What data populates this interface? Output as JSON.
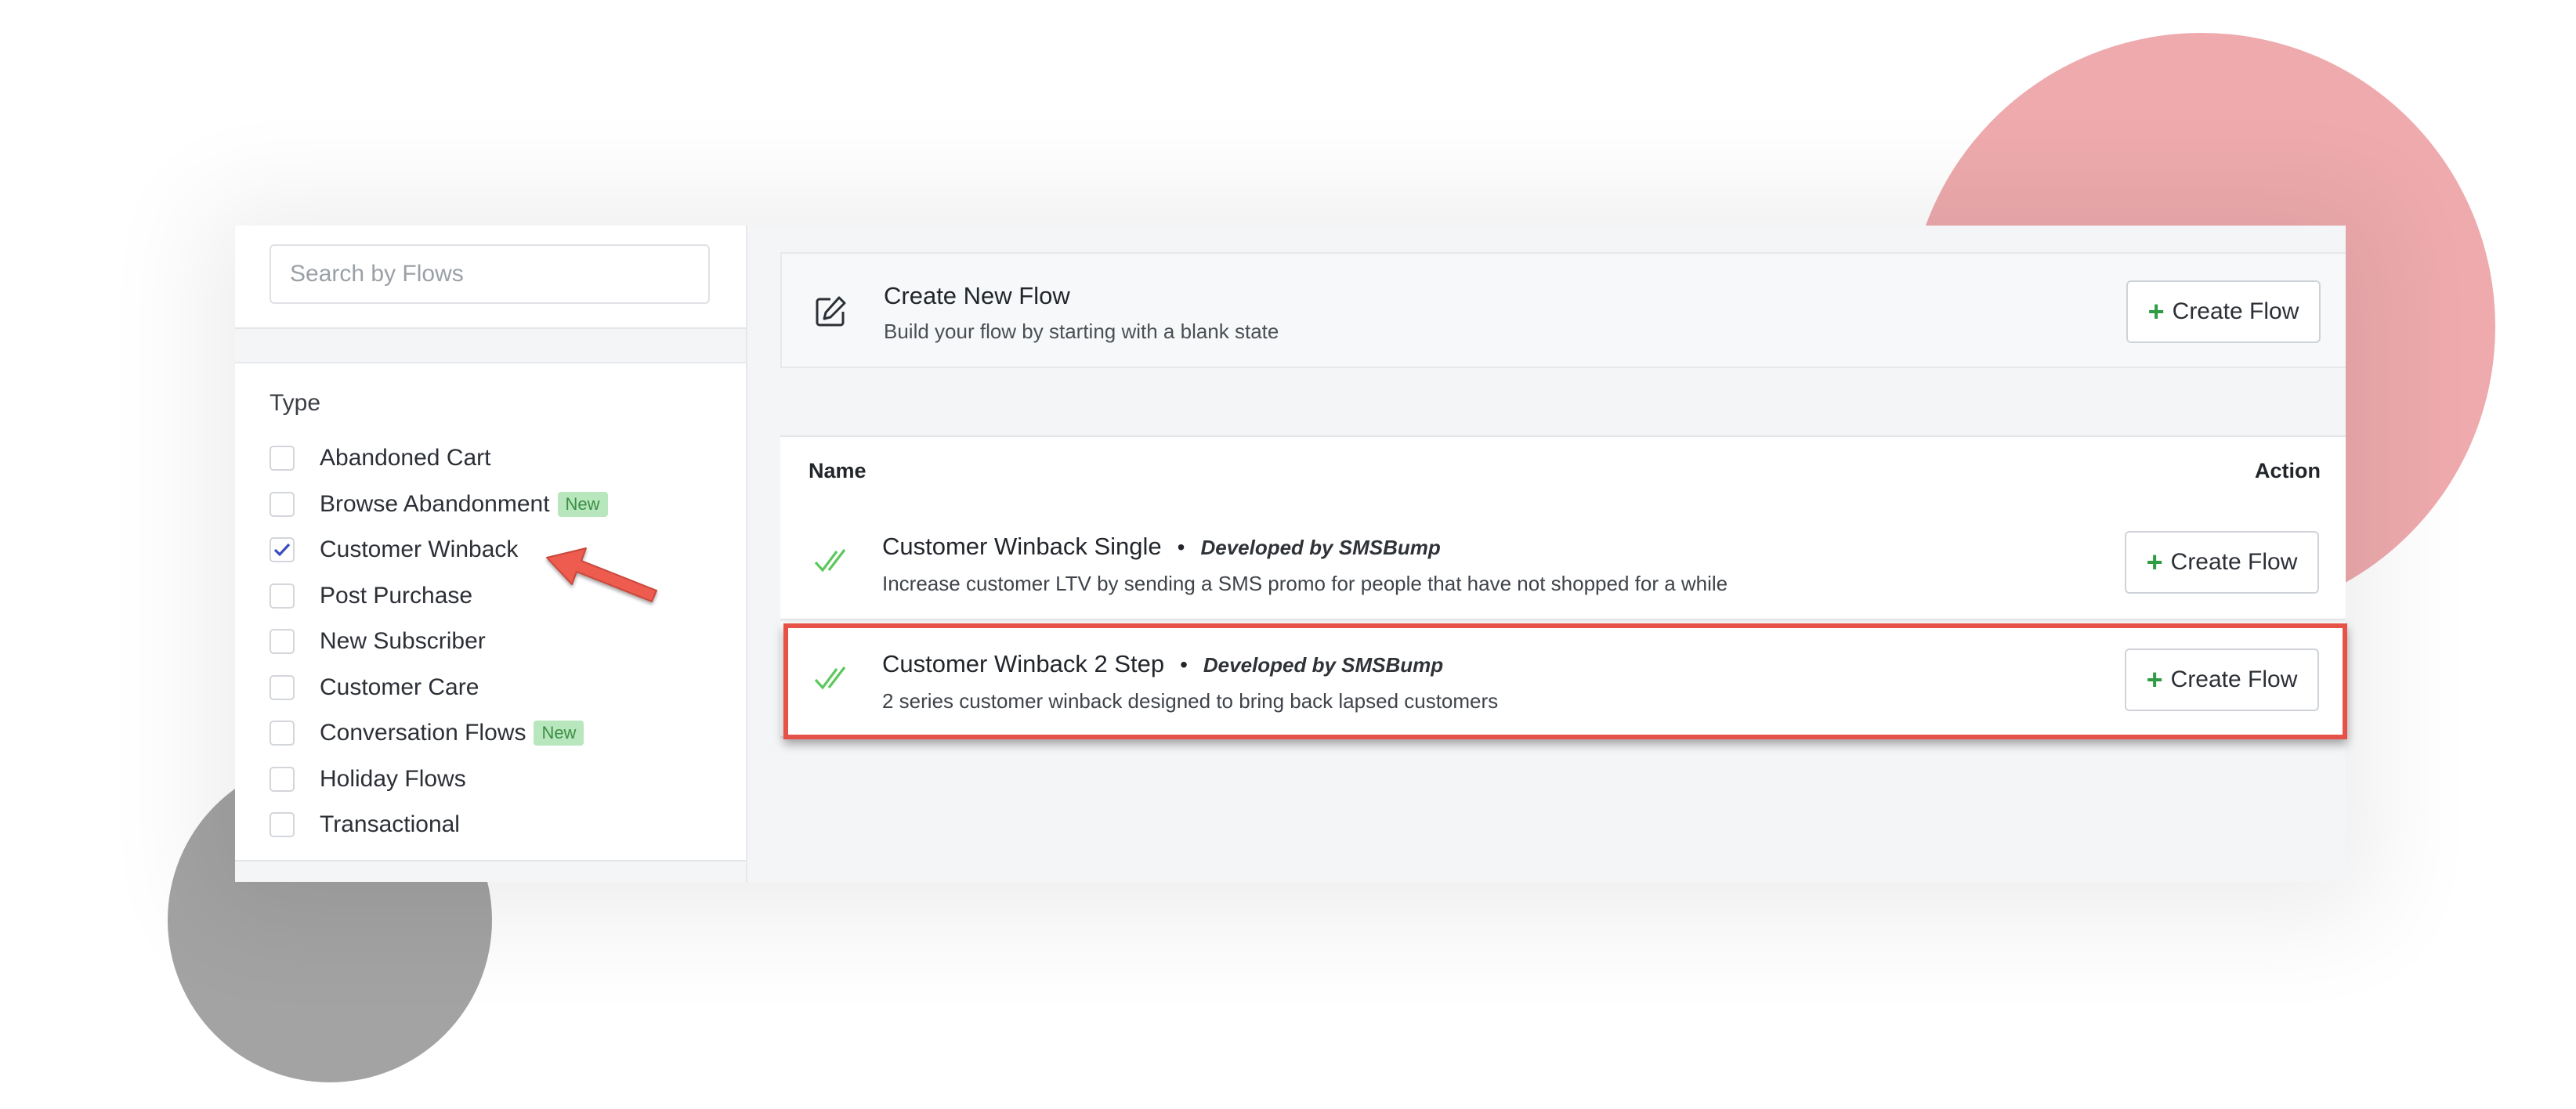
{
  "search": {
    "placeholder": "Search by Flows"
  },
  "filters": {
    "title": "Type",
    "items": [
      {
        "label": "Abandoned Cart",
        "checked": false,
        "badge": ""
      },
      {
        "label": "Browse Abandonment",
        "checked": false,
        "badge": "New"
      },
      {
        "label": "Customer Winback",
        "checked": true,
        "badge": ""
      },
      {
        "label": "Post Purchase",
        "checked": false,
        "badge": ""
      },
      {
        "label": "New Subscriber",
        "checked": false,
        "badge": ""
      },
      {
        "label": "Customer Care",
        "checked": false,
        "badge": ""
      },
      {
        "label": "Conversation Flows",
        "checked": false,
        "badge": "New"
      },
      {
        "label": "Holiday Flows",
        "checked": false,
        "badge": ""
      },
      {
        "label": "Transactional",
        "checked": false,
        "badge": ""
      }
    ]
  },
  "new_flow": {
    "title": "Create New Flow",
    "subtitle": "Build your flow by starting with a blank state",
    "button_label": "Create Flow"
  },
  "table": {
    "headers": {
      "name": "Name",
      "action": "Action"
    },
    "rows": [
      {
        "title": "Customer Winback Single",
        "developer": "Developed by SMSBump",
        "description": "Increase customer LTV by sending a SMS promo for people that have not shopped for a while",
        "button_label": "Create Flow"
      },
      {
        "title": "Customer Winback 2 Step",
        "developer": "Developed by SMSBump",
        "description": "2 series customer winback designed to bring back lapsed customers",
        "button_label": "Create Flow"
      }
    ]
  },
  "colors": {
    "accent_green": "#2f9c44",
    "check_green": "#5cc85c",
    "highlight_red": "#e65248",
    "checkbox_blue": "#3a4cc0",
    "badge_bg": "#b8e6bd"
  },
  "icons": {
    "edit": "edit-icon",
    "check": "double-check-icon",
    "plus": "plus-icon"
  }
}
